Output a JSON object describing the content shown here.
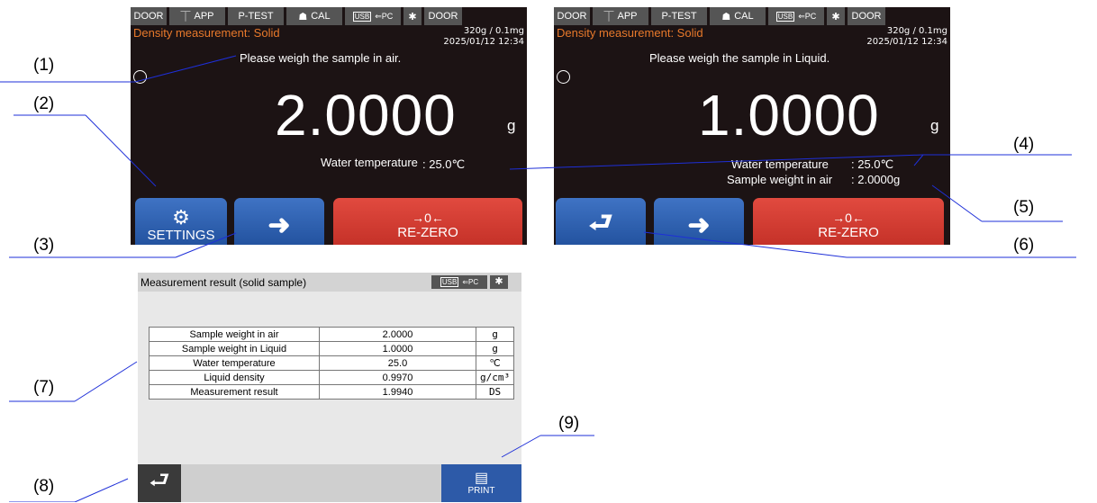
{
  "top_bar": {
    "items": [
      "DOOR",
      "APP",
      "P-TEST",
      "CAL",
      "USB",
      "PC",
      "DOOR"
    ],
    "usb": "USB",
    "pc": "PC"
  },
  "screen1": {
    "mode": "Density measurement: Solid",
    "range": "320g / 0.1mg",
    "datetime": "2025/01/12 12:34",
    "message": "Please weigh the sample in air.",
    "weight": "2.0000",
    "unit": "g",
    "water_temp_label": "Water temperature",
    "water_temp_value": ": 25.0℃",
    "buttons": {
      "settings": "SETTINGS",
      "rezero": "RE-ZERO",
      "rezero_symbol": "→0←"
    }
  },
  "screen2": {
    "mode": "Density measurement: Solid",
    "range": "320g / 0.1mg",
    "datetime": "2025/01/12 12:34",
    "message": "Please weigh the sample in Liquid.",
    "weight": "1.0000",
    "unit": "g",
    "water_temp_label": "Water temperature",
    "water_temp_value": ": 25.0℃",
    "sample_air_label": "Sample weight in air",
    "sample_air_value": ": 2.0000g",
    "buttons": {
      "rezero": "RE-ZERO",
      "rezero_symbol": "→0←"
    }
  },
  "result_panel": {
    "title": "Measurement result (solid sample)",
    "usb": "USB",
    "pc": "PC",
    "rows": [
      {
        "label": "Sample weight in air",
        "value": "2.0000",
        "unit": "g"
      },
      {
        "label": "Sample weight in Liquid",
        "value": "1.0000",
        "unit": "g"
      },
      {
        "label": "Water temperature",
        "value": "25.0",
        "unit": "℃"
      },
      {
        "label": "Liquid density",
        "value": "0.9970",
        "unit": "g/cm³"
      },
      {
        "label": "Measurement result",
        "value": "1.9940",
        "unit": "DS"
      }
    ],
    "print_label": "PRINT"
  },
  "callouts": [
    "(1)",
    "(2)",
    "(3)",
    "(4)",
    "(5)",
    "(6)",
    "(7)",
    "(8)",
    "(9)"
  ],
  "colors": {
    "screen_bg": "#1c1314",
    "mode_text": "#e8792b",
    "blue_button": "#2d5fb0",
    "red_button": "#d43b31",
    "panel_bg": "#e8e8e8"
  }
}
